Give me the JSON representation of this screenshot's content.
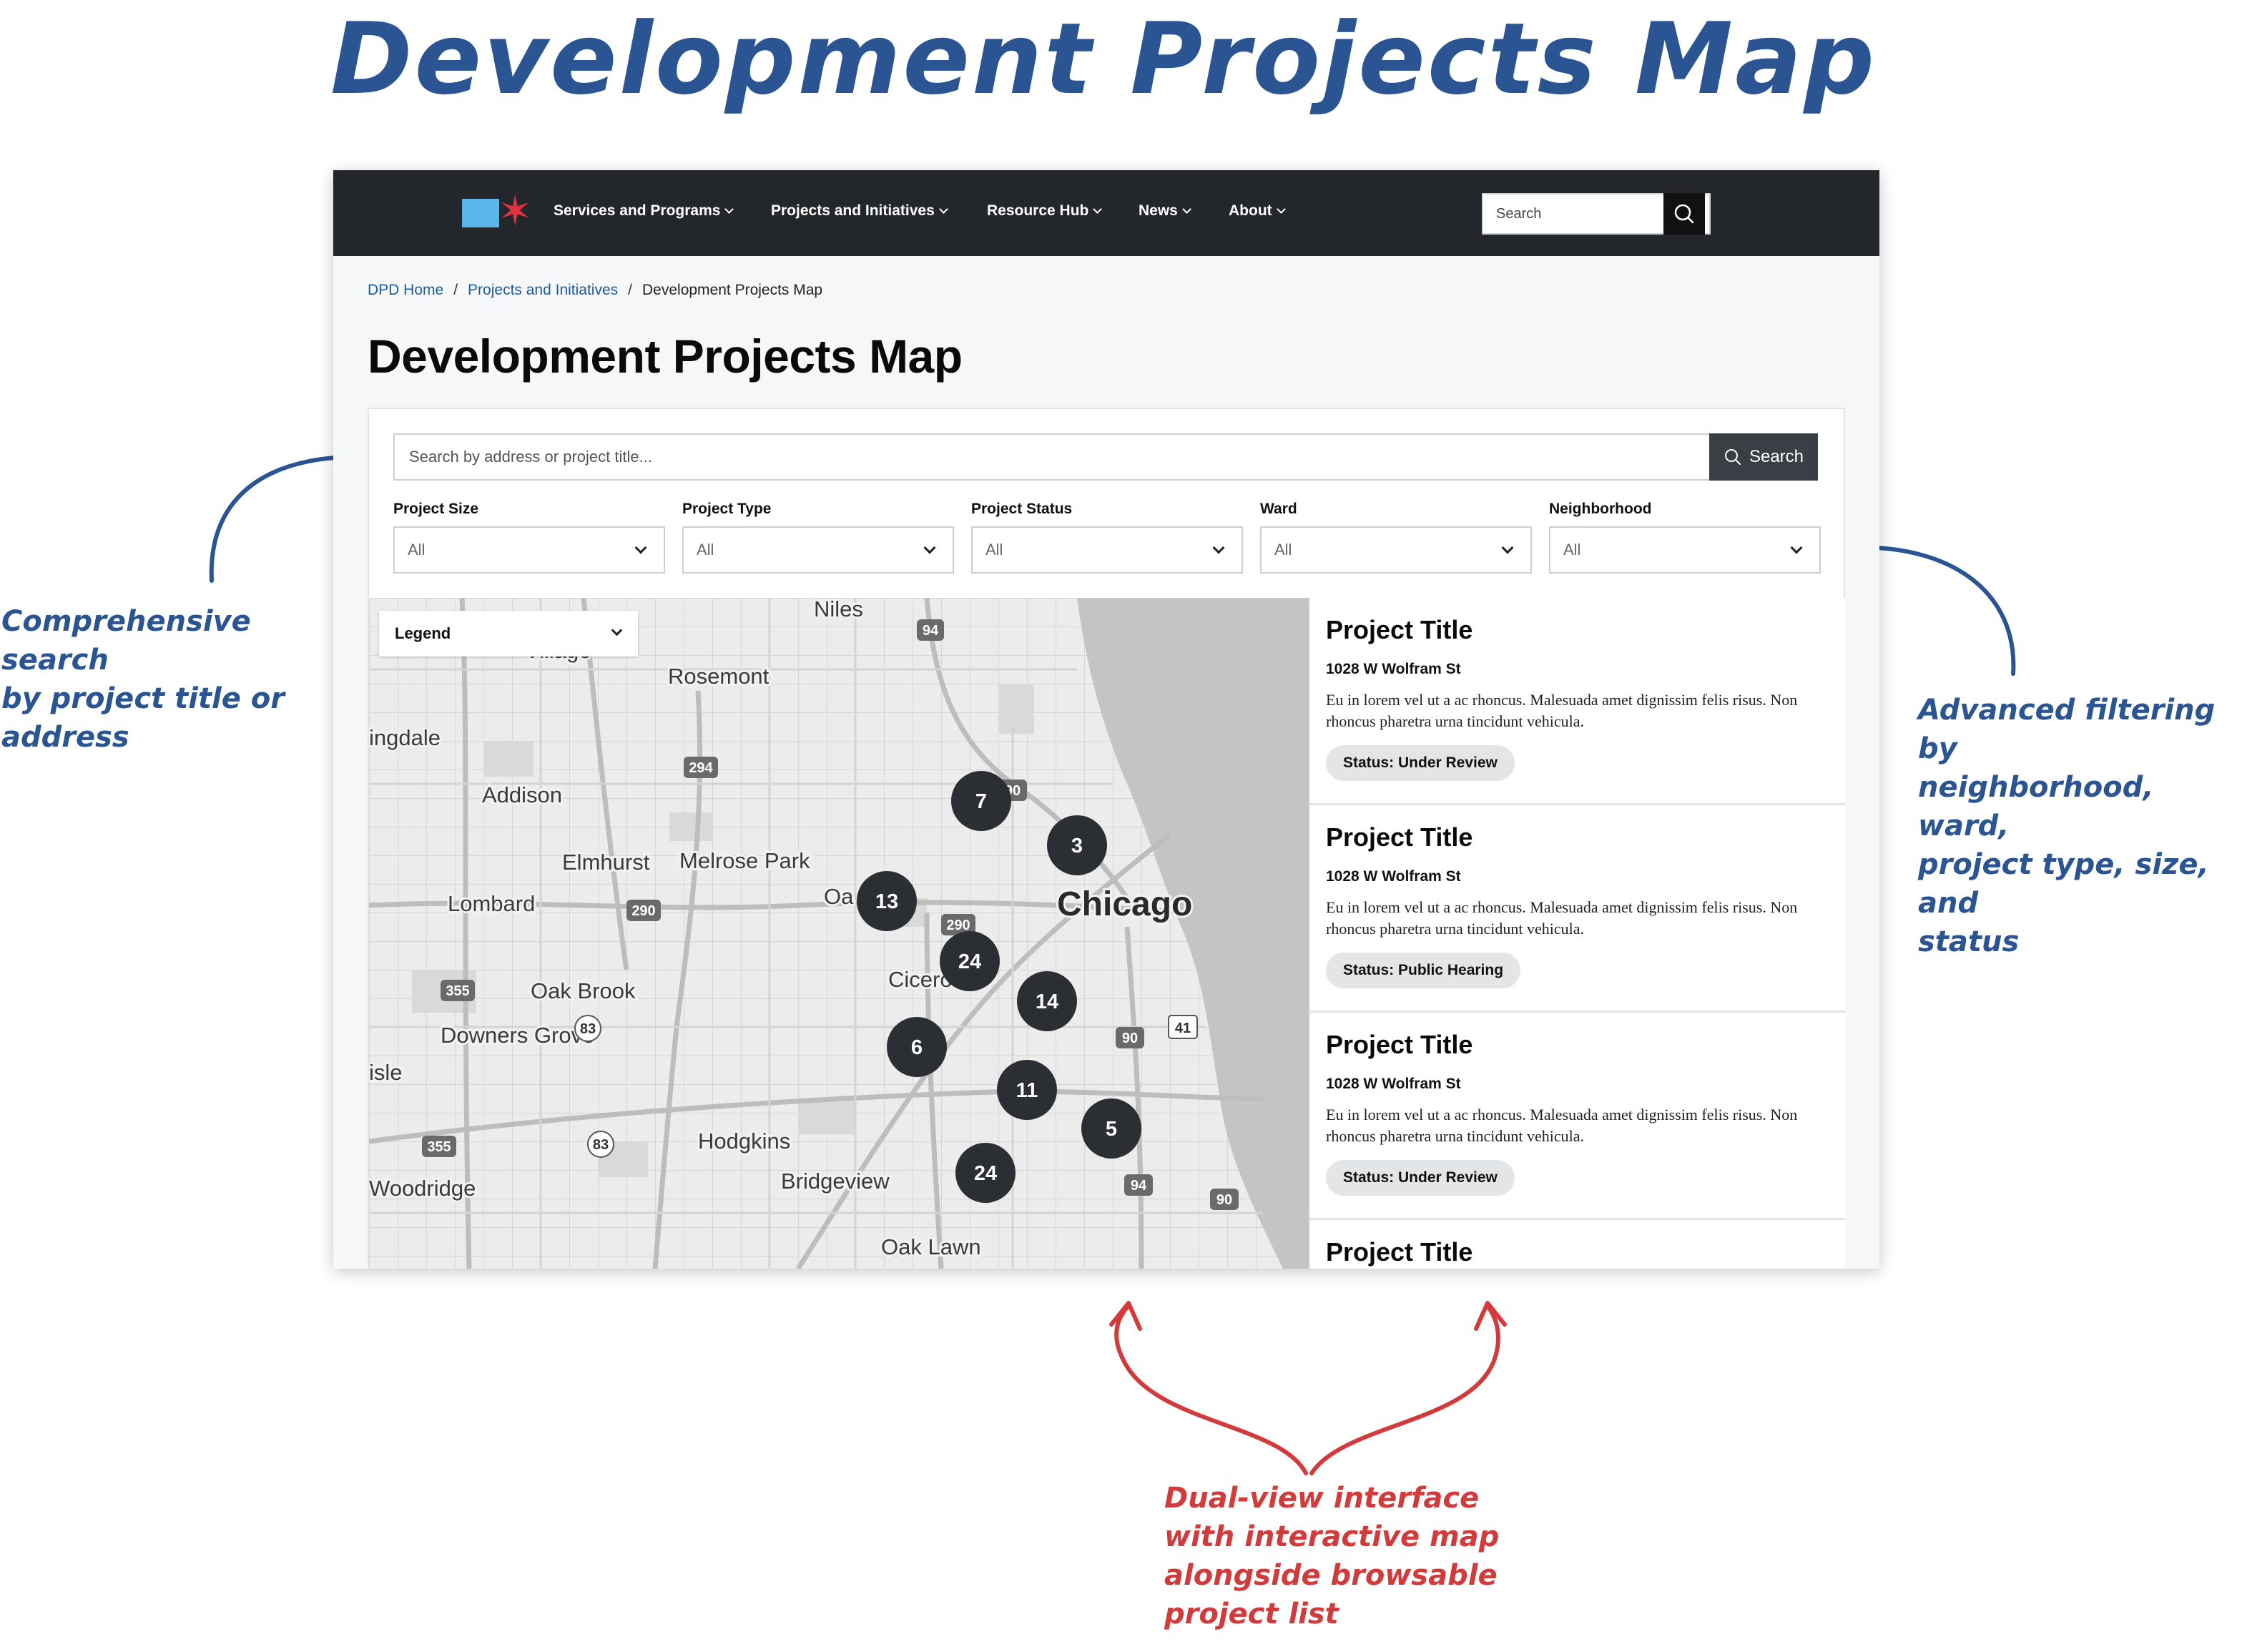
{
  "annotations": {
    "title": "Development Projects Map",
    "left_note": "Comprehensive search\nby project title or\naddress",
    "right_note": "Advanced filtering by\nneighborhood, ward,\nproject type, size, and\nstatus",
    "bottom_note": "Dual-view interface\nwith interactive map\nalongside browsable\nproject list",
    "colors": {
      "blue": "#2a5592",
      "red": "#d23b3b"
    }
  },
  "nav": {
    "items": [
      {
        "label": "Services and Programs"
      },
      {
        "label": "Projects and Initiatives"
      },
      {
        "label": "Resource Hub"
      },
      {
        "label": "News"
      },
      {
        "label": "About"
      }
    ],
    "search_placeholder": "Search",
    "colors": {
      "bar": "#23272c",
      "flag": "#5bb6e9",
      "star": "#e0333d"
    }
  },
  "breadcrumb": {
    "home": "DPD Home",
    "section": "Projects and Initiatives",
    "current": "Development Projects Map",
    "separator": "/"
  },
  "page": {
    "title": "Development Projects Map"
  },
  "search": {
    "placeholder": "Search by address or project title...",
    "button_label": "Search"
  },
  "filters": [
    {
      "label": "Project Size",
      "value": "All"
    },
    {
      "label": "Project Type",
      "value": "All"
    },
    {
      "label": "Project Status",
      "value": "All"
    },
    {
      "label": "Ward",
      "value": "All"
    },
    {
      "label": "Neighborhood",
      "value": "All"
    }
  ],
  "map": {
    "legend_label": "Legend",
    "place_labels": [
      "Niles",
      "Rosemont",
      "ingdale",
      "Addison",
      "Elmhurst",
      "Melrose Park",
      "Lombard",
      "Chicago",
      "Oak Brook",
      "Downers Grove",
      "Cicero",
      "isle",
      "Hodgkins",
      "Woodridge",
      "Bridgeview",
      "Oak Lawn",
      "Village",
      "Oa"
    ],
    "highway_shields": [
      "94",
      "294",
      "290",
      "355",
      "83",
      "90",
      "41",
      "355",
      "83",
      "94",
      "90",
      "290",
      "90"
    ],
    "clusters": [
      "7",
      "3",
      "13",
      "24",
      "14",
      "6",
      "11",
      "5",
      "24"
    ]
  },
  "projects": [
    {
      "title": "Project Title",
      "address": "1028 W Wolfram St",
      "description": "Eu in lorem vel ut a ac rhoncus. Malesuada amet dignissim felis risus. Non rhoncus pharetra urna tincidunt vehicula.",
      "status": "Status: Under Review"
    },
    {
      "title": "Project Title",
      "address": "1028 W Wolfram St",
      "description": "Eu in lorem vel ut a ac rhoncus. Malesuada amet dignissim felis risus. Non rhoncus pharetra urna tincidunt vehicula.",
      "status": "Status: Public Hearing"
    },
    {
      "title": "Project Title",
      "address": "1028 W Wolfram St",
      "description": "Eu in lorem vel ut a ac rhoncus. Malesuada amet dignissim felis risus. Non rhoncus pharetra urna tincidunt vehicula.",
      "status": "Status: Under Review"
    },
    {
      "title": "Project Title"
    }
  ]
}
